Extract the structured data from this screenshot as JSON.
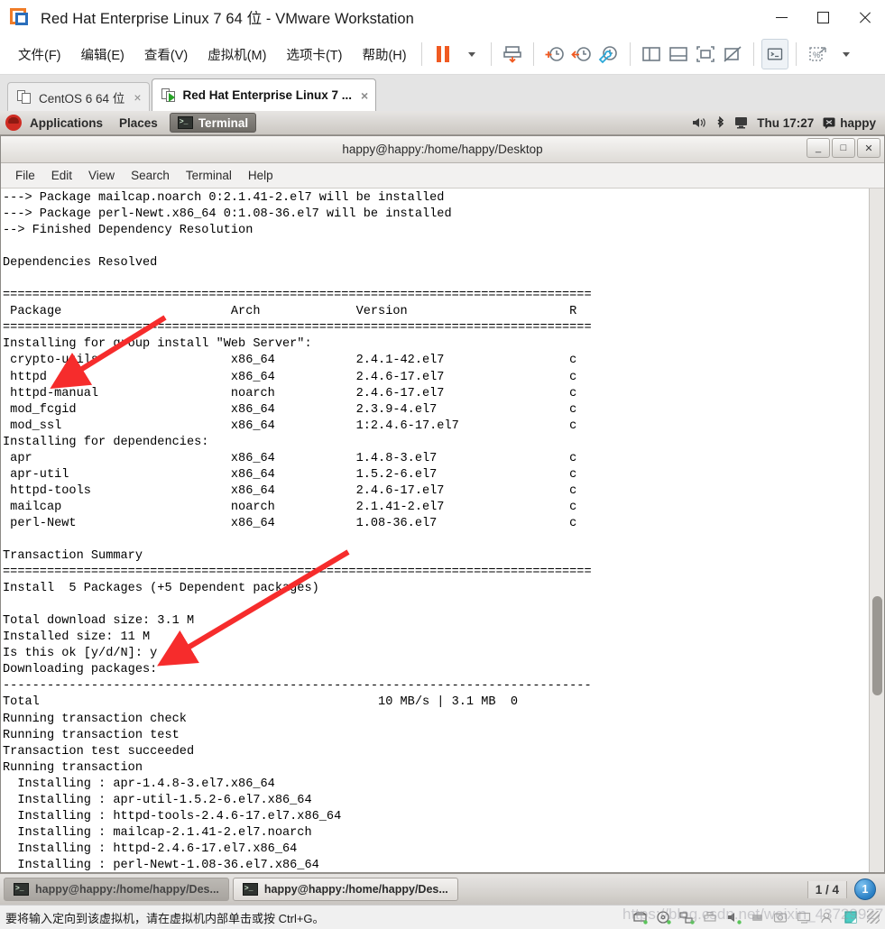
{
  "vmware": {
    "window_title": "Red Hat Enterprise Linux 7 64 位 - VMware Workstation",
    "logo_icon": "vmware-logo-icon",
    "window_controls": {
      "minimize": "minimize-icon",
      "maximize": "maximize-icon",
      "close": "close-icon"
    },
    "menus": [
      "文件(F)",
      "编辑(E)",
      "查看(V)",
      "虚拟机(M)",
      "选项卡(T)",
      "帮助(H)"
    ],
    "toolbar": [
      {
        "name": "suspend-button",
        "icon": "pause-icon"
      },
      {
        "name": "suspend-dropdown",
        "icon": "chevron-down-icon"
      },
      {
        "name": "power-on-guest-button",
        "icon": "power-download-icon"
      },
      {
        "name": "take-snapshot-button",
        "icon": "snapshot-add-icon"
      },
      {
        "name": "revert-snapshot-button",
        "icon": "snapshot-revert-icon"
      },
      {
        "name": "manage-snapshots-button",
        "icon": "snapshot-manage-icon"
      },
      {
        "name": "show-sidebar-button",
        "icon": "panel-left-icon"
      },
      {
        "name": "show-thumbnail-bar-button",
        "icon": "panel-bottom-icon"
      },
      {
        "name": "full-screen-button",
        "icon": "fullscreen-icon"
      },
      {
        "name": "unity-mode-button",
        "icon": "unity-icon"
      },
      {
        "name": "console-view-button",
        "icon": "terminal-icon"
      },
      {
        "name": "send-keystroke-button",
        "icon": "send-key-icon"
      },
      {
        "name": "send-keystroke-dropdown",
        "icon": "chevron-down-icon"
      }
    ],
    "tabs": [
      {
        "label": "CentOS 6 64 位",
        "icon": "vm-stopped-icon",
        "active": false,
        "close": "×"
      },
      {
        "label": "Red Hat Enterprise Linux 7 ...",
        "icon": "vm-running-icon",
        "active": true,
        "close": "×"
      }
    ],
    "status_message": "要将输入定向到该虚拟机，请在虚拟机内部单击或按 Ctrl+G。",
    "watermark": "https://blog.csdn.net/weixin_43729927",
    "tray_icons": [
      "hard-disk-icon",
      "cd-dvd-icon",
      "network-icon",
      "printer-icon",
      "sound-icon",
      "usb-icon",
      "camera-icon",
      "display-icon",
      "user-icon",
      "shared-folder-icon"
    ]
  },
  "guest_top_panel": {
    "logo_icon": "redhat-logo-icon",
    "applications_label": "Applications",
    "places_label": "Places",
    "active_app_label": "Terminal",
    "active_app_icon": "terminal-icon",
    "volume_icon": "volume-icon",
    "bluetooth_icon": "bluetooth-icon",
    "display_icon": "display-icon",
    "clock": "Thu 17:27",
    "user_icon": "chat-icon",
    "user": "happy"
  },
  "terminal_window": {
    "title": "happy@happy:/home/happy/Desktop",
    "buttons": {
      "minimize": "_",
      "maximize": "□",
      "close": "✕"
    },
    "menus": [
      "File",
      "Edit",
      "View",
      "Search",
      "Terminal",
      "Help"
    ],
    "content": "---> Package mailcap.noarch 0:2.1.41-2.el7 will be installed\n---> Package perl-Newt.x86_64 0:1.08-36.el7 will be installed\n--> Finished Dependency Resolution\n\nDependencies Resolved\n\n================================================================================\n Package                       Arch             Version                      R\n================================================================================\nInstalling for group install \"Web Server\":\n crypto-utils                  x86_64           2.4.1-42.el7                 c\n httpd                         x86_64           2.4.6-17.el7                 c\n httpd-manual                  noarch           2.4.6-17.el7                 c\n mod_fcgid                     x86_64           2.3.9-4.el7                  c\n mod_ssl                       x86_64           1:2.4.6-17.el7               c\nInstalling for dependencies:\n apr                           x86_64           1.4.8-3.el7                  c\n apr-util                      x86_64           1.5.2-6.el7                  c\n httpd-tools                   x86_64           2.4.6-17.el7                 c\n mailcap                       noarch           2.1.41-2.el7                 c\n perl-Newt                     x86_64           1.08-36.el7                  c\n\nTransaction Summary\n================================================================================\nInstall  5 Packages (+5 Dependent packages)\n\nTotal download size: 3.1 M\nInstalled size: 11 M\nIs this ok [y/d/N]: y\nDownloading packages:\n--------------------------------------------------------------------------------\nTotal                                              10 MB/s | 3.1 MB  0\nRunning transaction check\nRunning transaction test\nTransaction test succeeded\nRunning transaction\n  Installing : apr-1.4.8-3.el7.x86_64\n  Installing : apr-util-1.5.2-6.el7.x86_64\n  Installing : httpd-tools-2.4.6-17.el7.x86_64\n  Installing : mailcap-2.1.41-2.el7.noarch\n  Installing : httpd-2.4.6-17.el7.x86_64\n  Installing : perl-Newt-1.08-36.el7.x86_64"
  },
  "guest_bottom_panel": {
    "tasks": [
      {
        "label": "happy@happy:/home/happy/Des...",
        "icon": "terminal-icon",
        "selected": true
      },
      {
        "label": "happy@happy:/home/happy/Des...",
        "icon": "terminal-icon",
        "selected": false
      }
    ],
    "workspace_switcher": "1 / 4",
    "workspace_badge": "1"
  },
  "annotations": {
    "arrow1_target": "httpd",
    "arrow2_target": "Is this ok [y/d/N]: y",
    "color": "#f62c2c"
  }
}
